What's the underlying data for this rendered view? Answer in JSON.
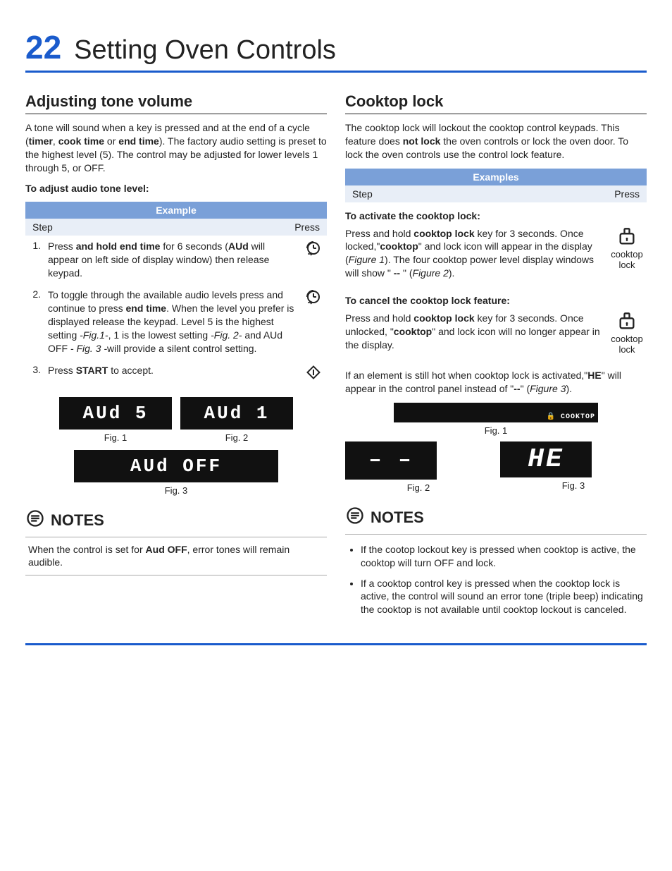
{
  "page": {
    "number": "22",
    "title": "Setting Oven Controls"
  },
  "left": {
    "heading": "Adjusting tone volume",
    "intro_html": "A tone will sound when a key is pressed and at the end of a cycle (<b>timer</b>, <b>cook time</b> or <b>end time</b>). The factory audio setting is preset to the highest level (5). The control may be adjusted for lower levels 1 through 5, or OFF.",
    "subhead": "To adjust audio tone level:",
    "table_title": "Example",
    "col_step": "Step",
    "col_press": "Press",
    "steps": [
      {
        "n": "1.",
        "html": "Press <b>and hold end time</b> for 6 seconds (<b>AUd</b> will appear on left side of display window) then release keypad.",
        "icon": "clock"
      },
      {
        "n": "2.",
        "html": "To toggle through the available audio levels press and continue to press <b>end time</b>. When the level you prefer is displayed release the keypad. Level 5 is the highest setting <i>-Fig.1-</i>, 1 is the lowest setting <i>-Fig. 2-</i> and AUd OFF <i>- Fig. 3 -</i>will provide a silent control setting.",
        "icon": "clock"
      },
      {
        "n": "3.",
        "html": "Press <b>START</b> to accept.",
        "icon": "diamond"
      }
    ],
    "disp1": "AUd    5",
    "disp2": "AUd      1",
    "disp3": "AUd  OFF",
    "fig1": "Fig. 1",
    "fig2": "Fig. 2",
    "fig3": "Fig. 3",
    "notes_title": "NOTES",
    "notes_html": "When the control is set for <b>Aud OFF</b>, error tones will remain audible."
  },
  "right": {
    "heading": "Cooktop lock",
    "intro_html": "The cooktop lock will lockout the cooktop control keypads. This feature does <b>not lock</b> the oven controls or lock the oven door. To lock the oven controls use the control lock feature.",
    "table_title": "Examples",
    "col_step": "Step",
    "col_press": "Press",
    "inst1_head": "To activate the cooktop lock:",
    "inst1_html": "Press and hold <b>cooktop lock</b> key for 3 seconds. Once locked,\"<b>cooktop</b>\" and lock icon will appear in the display (<i>Figure 1</i>). The four cooktop power level display windows will show \" <b>--</b> \" (<i>Figure 2</i>).",
    "inst2_head": "To cancel the cooktop lock feature:",
    "inst2_html": "Press and hold <b>cooktop lock</b> key for 3 seconds. Once unlocked,  \"<b>cooktop</b>\" and lock icon will no longer appear in the display.",
    "icon_caption": "cooktop lock",
    "after_html": "If an element is still hot when cooktop lock is activated,\"<b>HE</b>\" will appear in the control panel instead of \"<b>--</b>\" (<i>Figure 3</i>).",
    "banner": "🔒 COOKTOP",
    "fig1": "Fig. 1",
    "disp_a": "– –",
    "disp_b": "HE",
    "fig2": "Fig. 2",
    "fig3": "Fig. 3",
    "notes_title": "NOTES",
    "bullets": [
      " If the cootop lockout key is pressed when cooktop is active, the cooktop will turn OFF and lock.",
      "If a cooktop control key is pressed when the cooktop lock is active, the control will sound an error tone (triple beep) indicating the cooktop is not available until cooktop lockout is canceled."
    ]
  }
}
